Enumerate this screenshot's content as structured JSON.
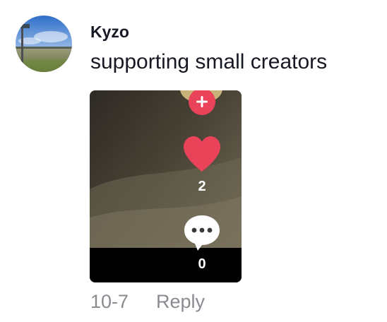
{
  "comment": {
    "username": "Kyzo",
    "text": "supporting small creators",
    "date": "10-7",
    "reply_label": "Reply"
  },
  "video": {
    "like_count": "2",
    "comment_count": "0",
    "plus_symbol": "+"
  },
  "icons": {
    "plus": "plus-icon",
    "heart": "heart-icon",
    "comment": "comment-bubble-icon"
  },
  "colors": {
    "accent_red": "#ea4359",
    "text_primary": "#161823",
    "text_secondary": "#8a8b91",
    "video_bar": "#000000"
  }
}
